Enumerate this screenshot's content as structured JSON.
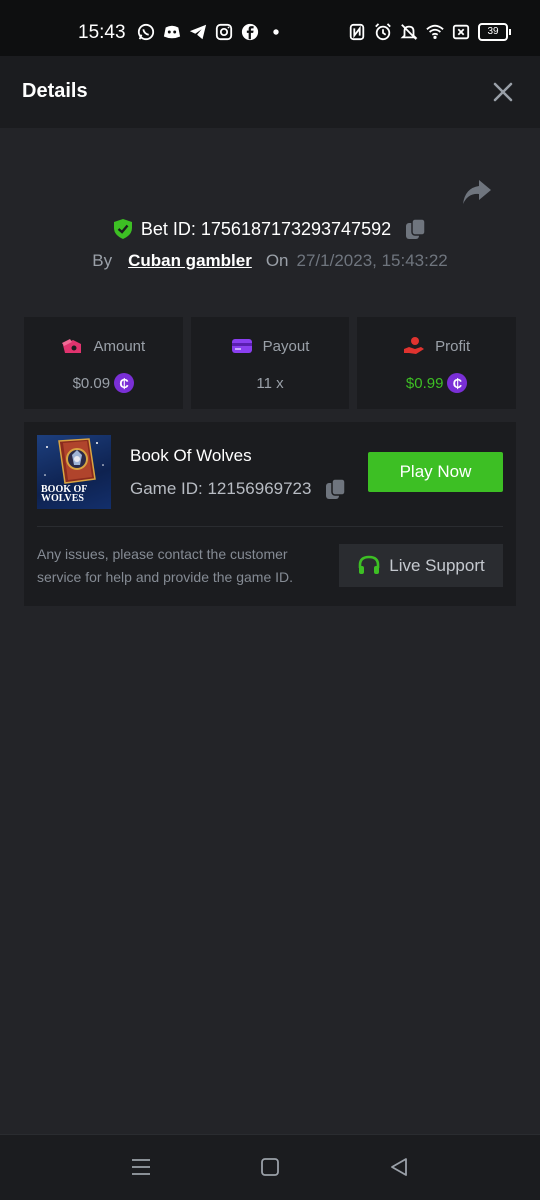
{
  "status": {
    "time": "15:43",
    "battery": "39",
    "left_icons": [
      "whatsapp-icon",
      "discord-icon",
      "telegram-icon",
      "instagram-icon",
      "facebook-icon",
      "dot-icon"
    ],
    "right_icons": [
      "nfc-icon",
      "alarm-icon",
      "bell-off-icon",
      "wifi-icon",
      "sim-icon",
      "battery-icon"
    ]
  },
  "header": {
    "title": "Details"
  },
  "bet": {
    "id_label": "Bet ID: 1756187173293747592",
    "by_label": "By",
    "user": "Cuban gambler",
    "on_label": "On",
    "date": "27/1/2023, 15:43:22"
  },
  "stats": {
    "amount": {
      "label": "Amount",
      "value": "$0.09"
    },
    "payout": {
      "label": "Payout",
      "value": "11 x"
    },
    "profit": {
      "label": "Profit",
      "value": "$0.99"
    },
    "coin_symbol": "₵"
  },
  "game": {
    "name": "Book Of Wolves",
    "id_label": "Game ID: 12156969723",
    "thumb_text": "BOOK OF WOLVES",
    "play_label": "Play Now",
    "help_text": "Any issues, please contact the customer service for help and provide the game ID.",
    "support_label": "Live Support"
  },
  "colors": {
    "background": "#232428",
    "panel": "#1b1c1f",
    "green": "#3dbf24",
    "coin": "#7a2fd6",
    "pink": "#e0336e",
    "purple": "#8a3ff0",
    "red": "#e0332f"
  }
}
